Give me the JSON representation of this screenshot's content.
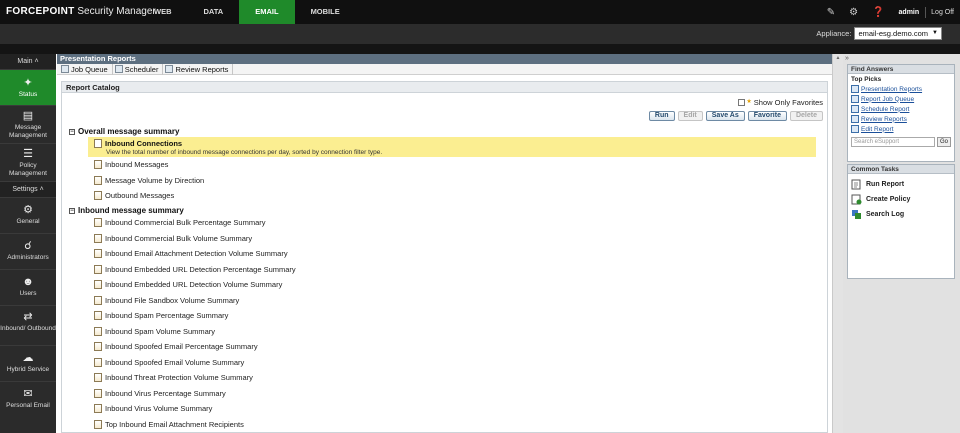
{
  "header": {
    "brand_bold": "FORCEPOINT",
    "brand_rest": "Security Manager",
    "tabs": [
      {
        "label": "WEB"
      },
      {
        "label": "DATA"
      },
      {
        "label": "EMAIL"
      },
      {
        "label": "MOBILE"
      }
    ],
    "active_tab": "EMAIL",
    "user": "admin",
    "logoff": "Log Off"
  },
  "subbar": {
    "appliance_label": "Appliance:",
    "appliance_value": "email-esg.demo.com"
  },
  "sidebar": {
    "main_label": "Main",
    "settings_label": "Settings",
    "items": [
      {
        "label": "Status",
        "icon": "status-icon"
      },
      {
        "label": "Message Management",
        "icon": "message-icon"
      },
      {
        "label": "Policy Management",
        "icon": "policy-icon"
      },
      {
        "label": "General",
        "icon": "gear-icon"
      },
      {
        "label": "Administrators",
        "icon": "administrators-icon"
      },
      {
        "label": "Users",
        "icon": "users-icon"
      },
      {
        "label": "Inbound/ Outbound",
        "icon": "arrows-icon"
      },
      {
        "label": "Hybrid Service",
        "icon": "cloud-icon"
      },
      {
        "label": "Personal Email",
        "icon": "envelope-icon"
      }
    ]
  },
  "content": {
    "title": "Presentation Reports",
    "tabs": [
      {
        "label": "Job Queue"
      },
      {
        "label": "Scheduler"
      },
      {
        "label": "Review Reports"
      }
    ],
    "catalog_title": "Report Catalog",
    "show_favorites": "Show Only Favorites",
    "buttons": {
      "run": "Run",
      "edit": "Edit",
      "save_as": "Save As",
      "favorite": "Favorite",
      "delete": "Delete"
    },
    "group1": {
      "title": "Overall message summary",
      "selected_title": "Inbound Connections",
      "selected_desc": "View the total number of inbound message connections per day, sorted by connection filter type.",
      "items": [
        "Inbound Messages",
        "Message Volume by Direction",
        "Outbound Messages"
      ]
    },
    "group2": {
      "title": "Inbound message summary",
      "items": [
        "Inbound Commercial Bulk Percentage Summary",
        "Inbound Commercial Bulk Volume Summary",
        "Inbound Email Attachment Detection Volume Summary",
        "Inbound Embedded URL Detection Percentage Summary",
        "Inbound Embedded URL Detection Volume Summary",
        "Inbound File Sandbox Volume Summary",
        "Inbound Spam Percentage Summary",
        "Inbound Spam Volume Summary",
        "Inbound Spoofed Email Percentage Summary",
        "Inbound Spoofed Email Volume Summary",
        "Inbound Threat Protection Volume Summary",
        "Inbound Virus Percentage Summary",
        "Inbound Virus Volume Summary",
        "Top Inbound Email Attachment Recipients"
      ]
    }
  },
  "right_panel": {
    "find_answers": "Find Answers",
    "top_picks": "Top Picks",
    "links": [
      "Presentation Reports",
      "Report Job Queue",
      "Schedule Report",
      "Review Reports",
      "Edit Report"
    ],
    "search_placeholder": "Search eSupport",
    "go": "Go",
    "common_tasks": "Common Tasks",
    "tasks": [
      "Run Report",
      "Create Policy",
      "Search Log"
    ]
  }
}
